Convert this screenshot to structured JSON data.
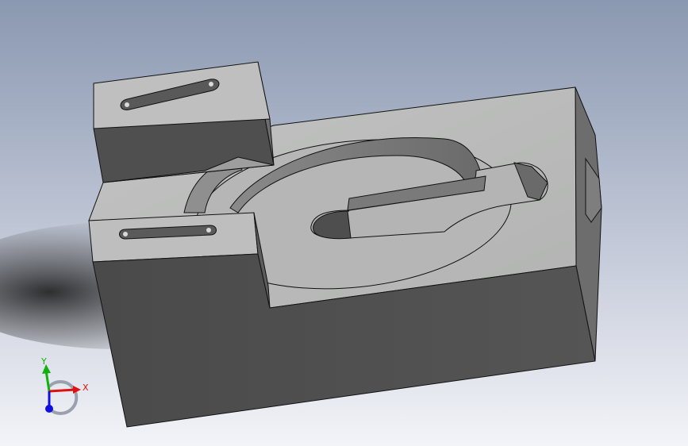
{
  "viewport": {
    "background_top": "#8d9bb3",
    "background_bottom": "#f2f3f7"
  },
  "model": {
    "face_top": "#b9bab9",
    "face_front": "#505050",
    "face_side": "#6f6f6f",
    "cut_wall": "#7c7c7c",
    "edge": "#111111"
  },
  "triad": {
    "x_label": "X",
    "y_label": "Y",
    "x_color": "#e01010",
    "y_color": "#10b010",
    "z_color": "#1010e0"
  }
}
